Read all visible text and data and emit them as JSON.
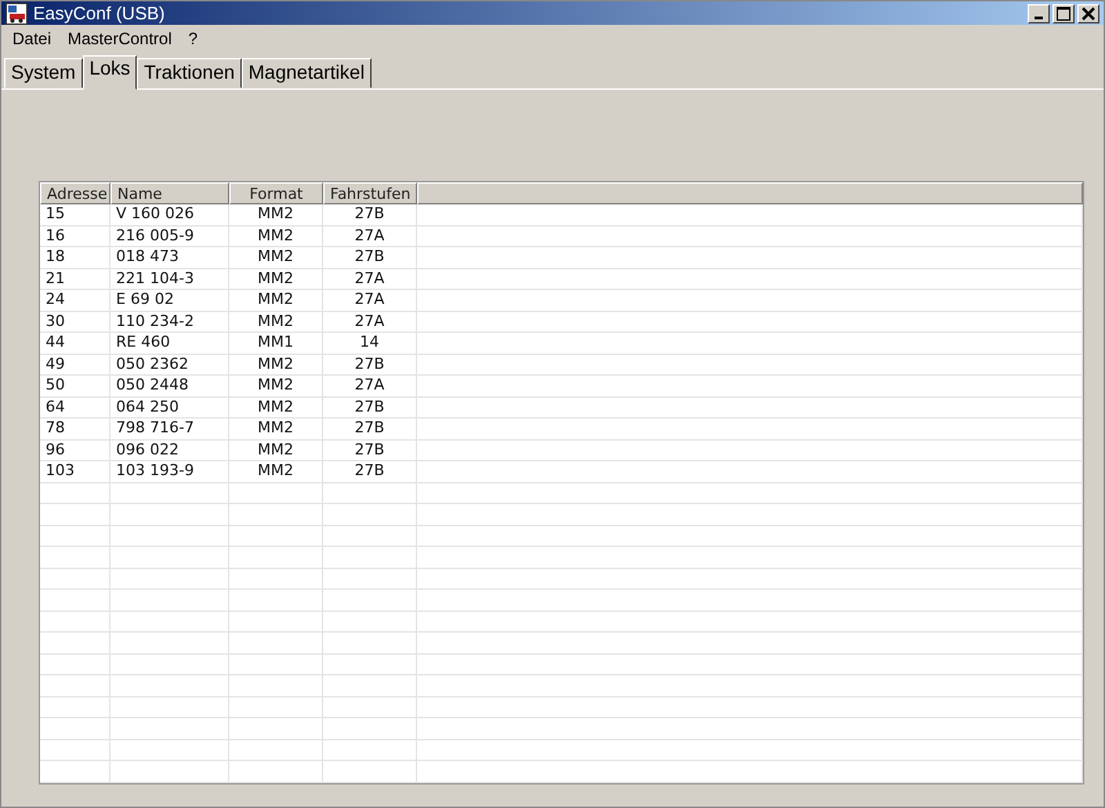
{
  "window": {
    "title": "EasyConf (USB)"
  },
  "menu": [
    "Datei",
    "MasterControl",
    "?"
  ],
  "tabs": [
    {
      "label": "System",
      "selected": false
    },
    {
      "label": "Loks",
      "selected": true
    },
    {
      "label": "Traktionen",
      "selected": false
    },
    {
      "label": "Magnetartikel",
      "selected": false
    }
  ],
  "table": {
    "columns": [
      "Adresse",
      "Name",
      "Format",
      "Fahrstufen"
    ],
    "rows": [
      [
        "15",
        "V 160 026",
        "MM2",
        "27B"
      ],
      [
        "16",
        "216 005-9",
        "MM2",
        "27A"
      ],
      [
        "18",
        "018 473",
        "MM2",
        "27B"
      ],
      [
        "21",
        "221 104-3",
        "MM2",
        "27A"
      ],
      [
        "24",
        "E 69 02",
        "MM2",
        "27A"
      ],
      [
        "30",
        "110 234-2",
        "MM2",
        "27A"
      ],
      [
        "44",
        "RE 460",
        "MM1",
        "14"
      ],
      [
        "49",
        "050 2362",
        "MM2",
        "27B"
      ],
      [
        "50",
        "050 2448",
        "MM2",
        "27A"
      ],
      [
        "64",
        "064 250",
        "MM2",
        "27B"
      ],
      [
        "78",
        "798 716-7",
        "MM2",
        "27B"
      ],
      [
        "96",
        "096 022",
        "MM2",
        "27B"
      ],
      [
        "103",
        "103 193-9",
        "MM2",
        "27B"
      ]
    ]
  }
}
